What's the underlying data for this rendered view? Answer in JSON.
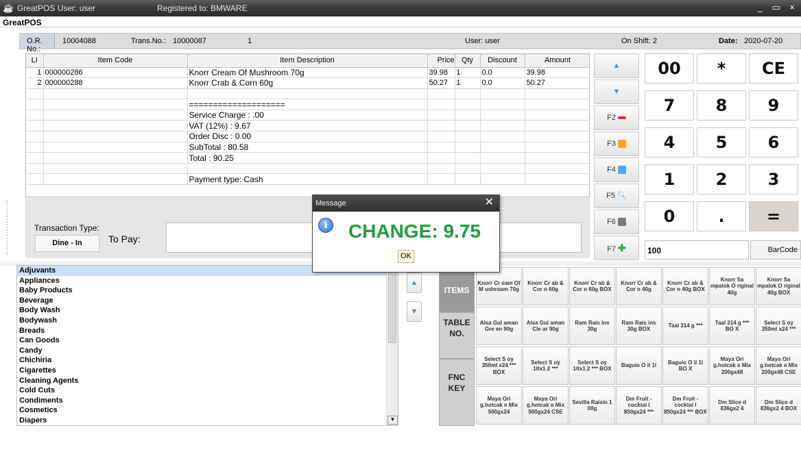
{
  "window": {
    "title": "GreatPOS User: user",
    "registered": "Registered to: BMWARE",
    "controls": "_ ▭ ×"
  },
  "app_name": "GreatPOS",
  "header": {
    "or_label": "O.R. No.:",
    "or_value": "10004088",
    "trans_label": "Trans.No.:",
    "trans_value": "10000087",
    "counter": "1",
    "user": "User: user",
    "shift": "On Shift: 2",
    "date_label": "Date:",
    "date_value": "2020-07-20"
  },
  "grid": {
    "columns": [
      "LI",
      "Item Code",
      "Item Description",
      "Price",
      "Qty",
      "Discount",
      "Amount"
    ],
    "rows": [
      [
        "1",
        "000000286",
        "Knorr Cream Of Mushroom 70g",
        "39.98",
        "1",
        "0.0",
        "39.98"
      ],
      [
        "2",
        "000000288",
        "Knorr Crab & Corn 60g",
        "50.27",
        "1",
        "0.0",
        "50.27"
      ],
      [
        "",
        "",
        "",
        "",
        "",
        "",
        ""
      ],
      [
        "",
        "",
        "====================",
        "",
        "",
        "",
        ""
      ],
      [
        "",
        "",
        "Service Charge : .00",
        "",
        "",
        "",
        ""
      ],
      [
        "",
        "",
        "VAT (12%) : 9.67",
        "",
        "",
        "",
        ""
      ],
      [
        "",
        "",
        "Order Disc : 0.00",
        "",
        "",
        "",
        ""
      ],
      [
        "",
        "",
        "SubTotal : 80.58",
        "",
        "",
        "",
        ""
      ],
      [
        "",
        "",
        "Total : 90.25",
        "",
        "",
        "",
        ""
      ],
      [
        "",
        "",
        "",
        "",
        "",
        "",
        ""
      ],
      [
        "",
        "",
        "Payment type: Cash",
        "",
        "",
        "",
        ""
      ]
    ]
  },
  "transaction": {
    "type_label": "Transaction Type:",
    "type_value": "Dine - In",
    "topay_label": "To Pay:"
  },
  "fkeys": [
    "F2",
    "F3",
    "F4",
    "F5",
    "F6",
    "F7"
  ],
  "numpad": [
    "00",
    "*",
    "CE",
    "7",
    "8",
    "9",
    "4",
    "5",
    "6",
    "1",
    "2",
    "3",
    "0",
    ".",
    "="
  ],
  "quantity": "100",
  "barcode_label": "BarCode",
  "categories": [
    "Adjuvants",
    "Appliances",
    "Baby Products",
    "Beverage",
    "Body Wash",
    "Bodywash",
    "Breads",
    "Can Goods",
    "Candy",
    "Chichiria",
    "Cigarettes",
    "Cleaning Agents",
    "Cold Cuts",
    "Condiments",
    "Cosmetics",
    "Diapers"
  ],
  "side_tabs": [
    "ITEMS",
    "TABLE NO.",
    "FNC KEY"
  ],
  "items": [
    "Knorr Cr eam Of M ushroom 70g",
    "Knorr Cr ab & Cor n 60g",
    "Knorr Cr ab & Cor n 60g BOX",
    "Knorr Cr ab & Cor n 40g",
    "Knorr Cr ab & Cor n 40g BOX",
    "Knorr Sa mpalok O riginal 40g",
    "Knorr Sa mpalok O riginal 40g BOX",
    "Alsa Gul aman Gre en 90g",
    "Alsa Gul aman Cle ar 90g",
    "Ram Rais ins 30g",
    "Ram Rais ins 30g BOX",
    "Taal 314 g ***",
    "Taal 314 g *** BO X",
    "Select S oy 350ml x24 ***",
    "Select S oy 350ml x24 *** BOX",
    "Select S oy 1ltx1 2 ***",
    "Select S oy 1ltx1 2 *** BOX",
    "Baguio O il 1l",
    "Baguio O il 1l BO X",
    "Maya Ori g.hotcak e Mix 200gx48",
    "Maya Ori g.hotcak e Mix 200gx48 CSE",
    "Maya Ori g.hotcak e Mix 500gx24",
    "Maya Ori g.hotcak e Mix 500gx24 CSE",
    "Sevilla Raisin 1 00g",
    "Dm Fruit -cocktai l 850gx24 ***",
    "Dm Fruit -cocktai l 850gx24 *** BOX",
    "Dm Slice d 836gx2 4",
    "Dm Slice d 836gx2 4 BOX"
  ],
  "dialog": {
    "title": "Message",
    "text": "CHANGE: 9.75",
    "ok": "OK",
    "icon": "i"
  }
}
